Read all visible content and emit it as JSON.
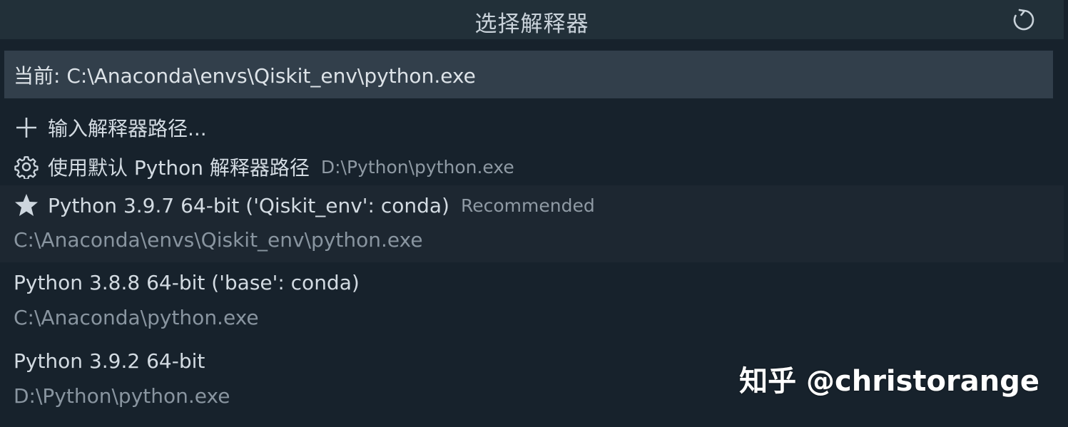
{
  "header": {
    "title": "选择解释器"
  },
  "search": {
    "value": "当前: C:\\Anaconda\\envs\\Qiskit_env\\python.exe"
  },
  "items": [
    {
      "icon": "plus-icon",
      "label": "输入解释器路径...",
      "description": ""
    },
    {
      "icon": "gear-icon",
      "label": "使用默认 Python 解释器路径",
      "description": "D:\\Python\\python.exe"
    },
    {
      "icon": "star-icon",
      "label": "Python 3.9.7 64-bit ('Qiskit_env': conda)",
      "description": "Recommended",
      "detail": "C:\\Anaconda\\envs\\Qiskit_env\\python.exe"
    },
    {
      "label": "Python 3.8.8 64-bit ('base': conda)",
      "detail": "C:\\Anaconda\\python.exe"
    },
    {
      "label": "Python 3.9.2 64-bit",
      "detail": "D:\\Python\\python.exe"
    }
  ],
  "watermark": "知乎 @christorange",
  "colors": {
    "background": "#17222c",
    "titlebar": "#223039",
    "input": "#323f4b",
    "active_row": "#1d2731"
  }
}
